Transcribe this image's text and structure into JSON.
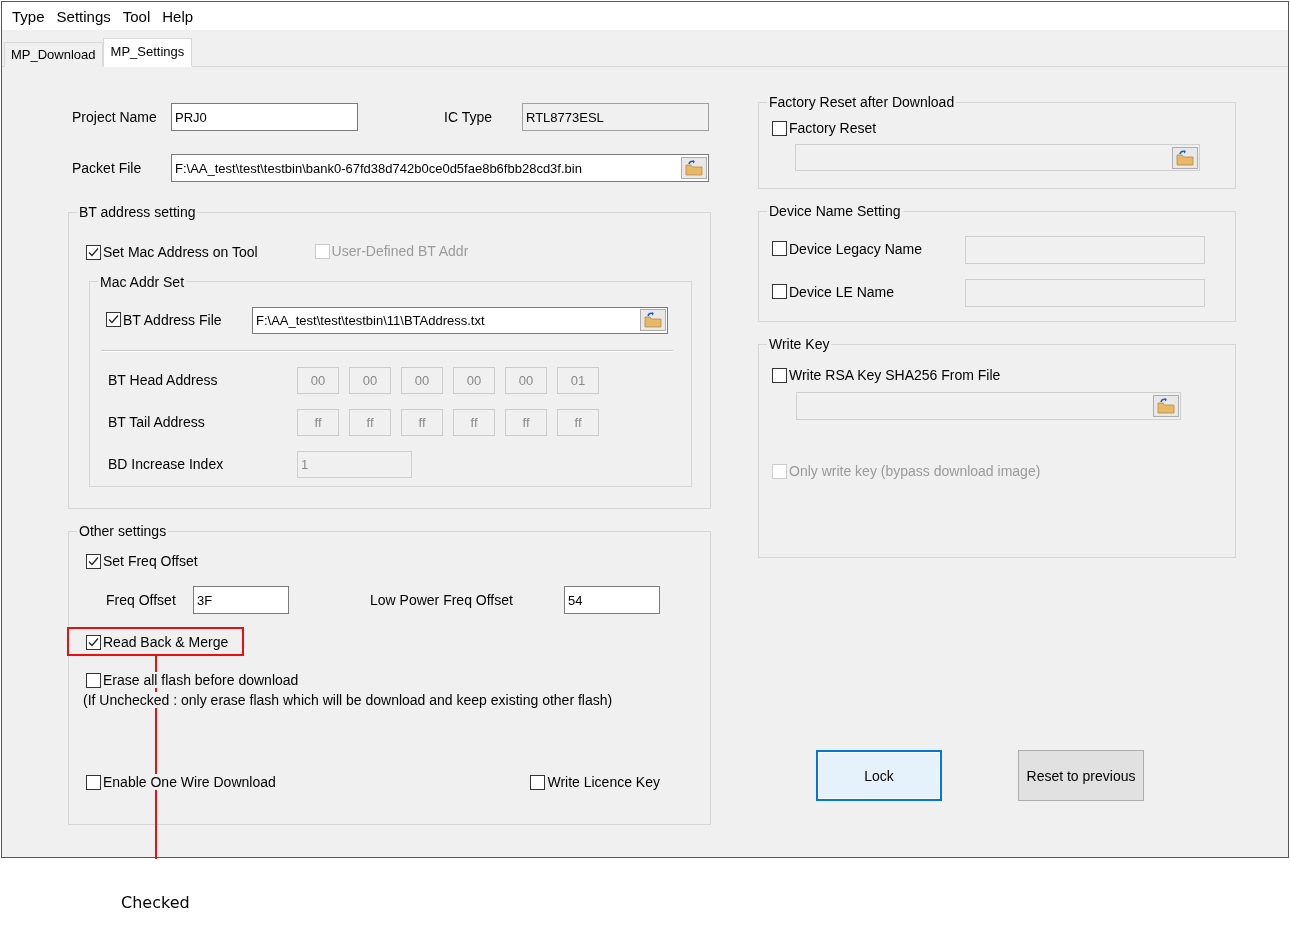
{
  "menu": [
    {
      "label": "Type"
    },
    {
      "label": "Settings"
    },
    {
      "label": "Tool"
    },
    {
      "label": "Help"
    }
  ],
  "tabs": [
    {
      "label": "MP_Download",
      "selected": false
    },
    {
      "label": "MP_Settings",
      "selected": true
    }
  ],
  "project": {
    "project_name_label": "Project Name",
    "project_name_value": "PRJ0",
    "ic_type_label": "IC Type",
    "ic_type_value": "RTL8773ESL",
    "packet_file_label": "Packet File",
    "packet_file_value": "F:\\AA_test\\test\\testbin\\bank0-67fd38d742b0ce0d5fae8b6fbb28cd3f.bin"
  },
  "bt_address_setting": {
    "title": "BT address setting",
    "set_mac": {
      "label": "Set Mac Address on Tool",
      "checked": true,
      "disabled": false
    },
    "user_defined": {
      "label": "User-Defined BT Addr",
      "checked": false,
      "disabled": true
    },
    "mac_addr_set": {
      "title": "Mac Addr Set",
      "bt_address_file": {
        "label": "BT Address File",
        "checked": true,
        "disabled": false,
        "value": "F:\\AA_test\\test\\testbin\\11\\BTAddress.txt"
      },
      "head": {
        "label": "BT Head Address",
        "bytes": [
          "00",
          "00",
          "00",
          "00",
          "00",
          "01"
        ]
      },
      "tail": {
        "label": "BT Tail Address",
        "bytes": [
          "ff",
          "ff",
          "ff",
          "ff",
          "ff",
          "ff"
        ]
      },
      "increase": {
        "label": "BD Increase Index",
        "value": "1",
        "disabled": true
      }
    }
  },
  "other_settings": {
    "title": "Other settings",
    "set_freq_offset": {
      "label": "Set Freq Offset",
      "checked": true,
      "disabled": false
    },
    "freq_offset": {
      "label": "Freq Offset",
      "value": "3F"
    },
    "low_power_freq_offset": {
      "label": "Low Power Freq Offset",
      "value": "54"
    },
    "read_back_merge": {
      "label": "Read Back & Merge",
      "checked": true,
      "disabled": false
    },
    "erase_all_flash": {
      "label": "Erase all flash before download",
      "checked": false,
      "disabled": false
    },
    "note": "(If Unchecked : only erase flash which will be download and keep existing other flash)",
    "one_wire": {
      "label": "Enable One Wire Download",
      "checked": false,
      "disabled": false
    },
    "licence_key": {
      "label": "Write Licence Key",
      "checked": false,
      "disabled": false
    }
  },
  "factory_reset": {
    "title": "Factory Reset after Download",
    "checkbox": {
      "label": "Factory Reset",
      "checked": false,
      "disabled": false
    }
  },
  "device_name": {
    "title": "Device Name Setting",
    "legacy": {
      "label": "Device Legacy Name",
      "checked": false,
      "disabled": false
    },
    "le": {
      "label": "Device LE Name",
      "checked": false,
      "disabled": false
    }
  },
  "write_key": {
    "title": "Write Key",
    "rsa": {
      "label": "Write RSA Key SHA256 From File",
      "checked": false,
      "disabled": false
    },
    "only_write": {
      "label": "Only write key (bypass download image)",
      "checked": false,
      "disabled": true
    }
  },
  "buttons": [
    {
      "label": "Lock",
      "focused": true
    },
    {
      "label": "Reset to previous",
      "focused": false
    }
  ],
  "annotation": {
    "label": "Checked"
  }
}
